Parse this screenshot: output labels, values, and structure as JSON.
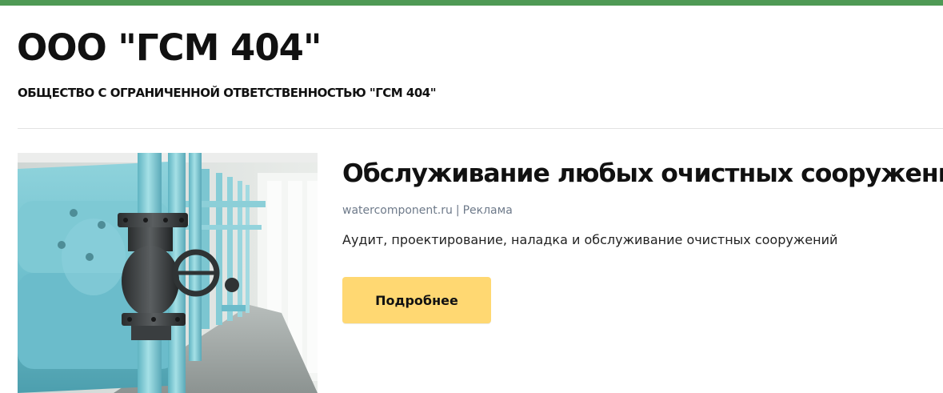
{
  "header": {
    "title": "ООО \"ГСМ 404\"",
    "subtitle": "ОБЩЕСТВО С ОГРАНИЧЕННОЙ ОТВЕТСТВЕННОСТЬЮ \"ГСМ 404\""
  },
  "ad": {
    "headline": "Обслуживание любых очистных сооружений",
    "domain": "watercomponent.ru",
    "separator": "|",
    "label": "Реклама",
    "description": "Аудит, проектирование, наладка и обслуживание очистных сооружений",
    "button_label": "Подробнее",
    "image_subject": "industrial-pipes-valve-photo"
  },
  "colors": {
    "top_bar": "#4f9a55",
    "button_bg": "#ffd872",
    "meta_text": "#6e7a8a",
    "divider": "#e3e3e3"
  }
}
